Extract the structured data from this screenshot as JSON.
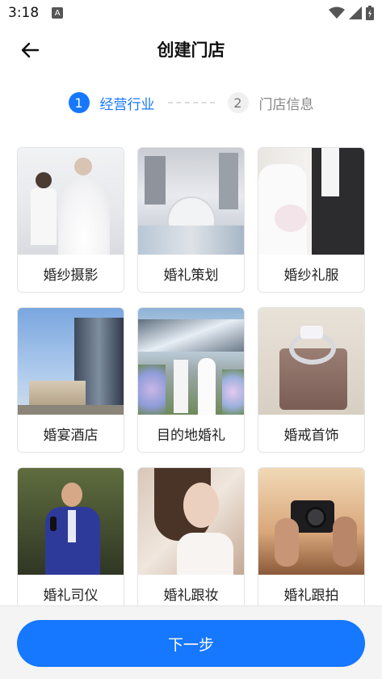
{
  "status_bar": {
    "time": "3:18",
    "notification_badge": "A",
    "icons": [
      "wifi-icon",
      "signal-icon",
      "battery-icon"
    ]
  },
  "header": {
    "title": "创建门店",
    "back_icon": "arrow-left-icon"
  },
  "stepper": {
    "steps": [
      {
        "number": "1",
        "label": "经营行业",
        "state": "active"
      },
      {
        "number": "2",
        "label": "门店信息",
        "state": "inactive"
      }
    ]
  },
  "industries": [
    {
      "label": "婚纱摄影"
    },
    {
      "label": "婚礼策划"
    },
    {
      "label": "婚纱礼服"
    },
    {
      "label": "婚宴酒店"
    },
    {
      "label": "目的地婚礼"
    },
    {
      "label": "婚戒首饰"
    },
    {
      "label": "婚礼司仪"
    },
    {
      "label": "婚礼跟妆"
    },
    {
      "label": "婚礼跟拍"
    }
  ],
  "footer": {
    "next_button": "下一步"
  },
  "colors": {
    "primary": "#1677ff",
    "inactive_step_bg": "#f0f0f0",
    "footer_bg": "#f4f4f4"
  }
}
